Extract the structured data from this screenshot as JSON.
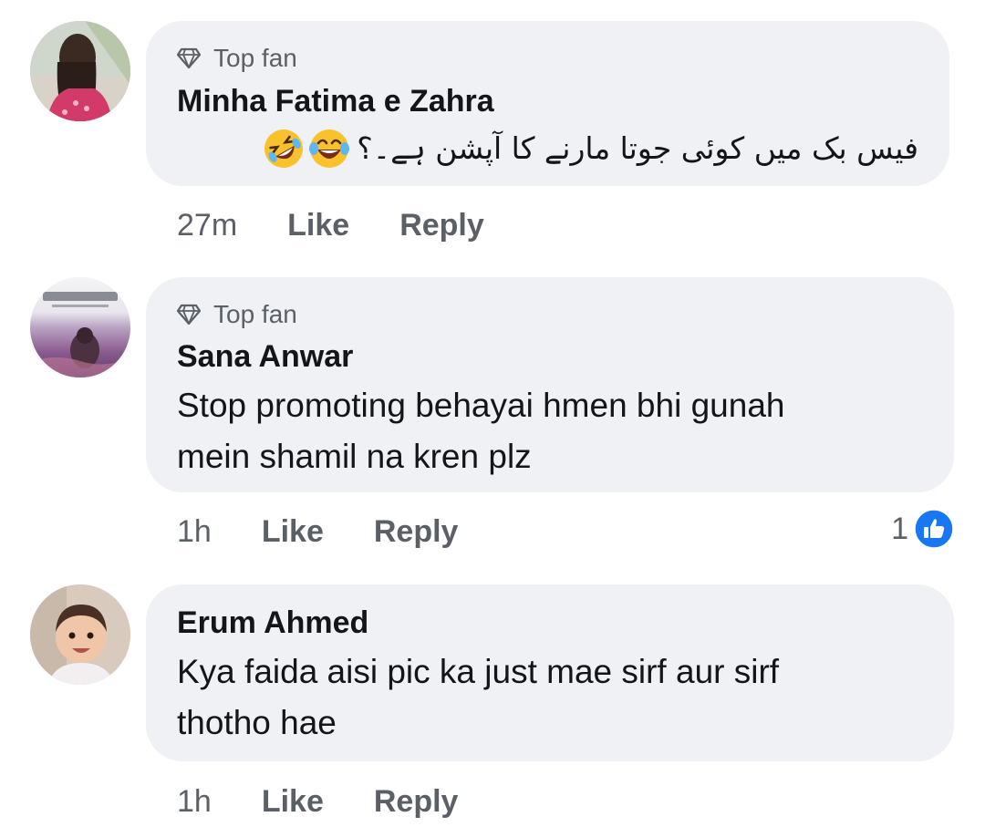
{
  "comments": [
    {
      "badge": "Top fan",
      "name": "Minha Fatima e Zahra",
      "text": "فیس بک میں کوئی جوتا مارنے کا آپشن ہے۔؟",
      "emojis": [
        "rolling-on-floor-laughing",
        "face-with-tears-of-joy"
      ],
      "time": "27m",
      "like_label": "Like",
      "reply_label": "Reply"
    },
    {
      "badge": "Top fan",
      "name": "Sana Anwar",
      "text_line1": "Stop promoting behayai hmen bhi gunah",
      "text_line2": "mein shamil na kren plz",
      "time": "1h",
      "like_label": "Like",
      "reply_label": "Reply",
      "reaction_count": "1",
      "reaction_color": "#1877f2"
    },
    {
      "name": "Erum Ahmed",
      "text_line1": "Kya faida aisi pic ka just mae sirf aur sirf",
      "text_line2": "thotho hae",
      "time": "1h",
      "like_label": "Like",
      "reply_label": "Reply"
    }
  ],
  "colors": {
    "bubble": "#eff1f4",
    "secondary_text": "#5b5f66",
    "primary_text": "#141518",
    "like_blue": "#1877f2"
  }
}
